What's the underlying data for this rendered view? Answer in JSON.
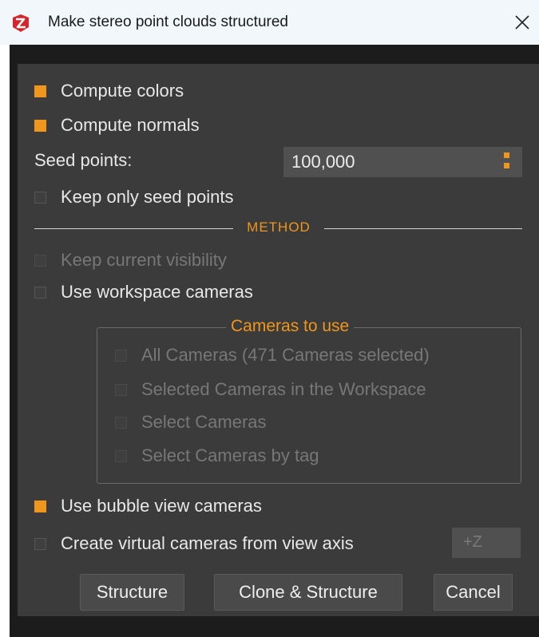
{
  "window": {
    "title": "Make stereo point clouds structured",
    "icon": "app-logo-icon",
    "close_icon": "close-icon"
  },
  "options": {
    "compute_colors": {
      "label": "Compute colors",
      "checked": true
    },
    "compute_normals": {
      "label": "Compute normals",
      "checked": true
    },
    "seed_points": {
      "label": "Seed points:",
      "value": "100,000"
    },
    "keep_only_seed": {
      "label": "Keep only seed points",
      "checked": false
    }
  },
  "method": {
    "title": "METHOD",
    "keep_current_visibility": {
      "label": "Keep current visibility",
      "checked": false,
      "enabled": false
    },
    "use_workspace_cameras": {
      "label": "Use workspace cameras",
      "checked": false
    }
  },
  "cameras_to_use": {
    "title": "Cameras to use",
    "items": [
      {
        "label": "All Cameras (471 Cameras selected)",
        "checked": false,
        "enabled": false
      },
      {
        "label": "Selected Cameras in the Workspace",
        "checked": false,
        "enabled": false
      },
      {
        "label": "Select Cameras",
        "checked": false,
        "enabled": false
      },
      {
        "label": "Select Cameras by tag",
        "checked": false,
        "enabled": false
      }
    ]
  },
  "bubble": {
    "label": "Use bubble view cameras",
    "checked": true
  },
  "virtual": {
    "label": "Create virtual cameras from view axis",
    "checked": false,
    "axis_value": "+Z"
  },
  "buttons": {
    "structure": "Structure",
    "clone_structure": "Clone & Structure",
    "cancel": "Cancel"
  },
  "colors": {
    "accent": "#f0961c",
    "panel_bg": "#3b3b3b",
    "frame_bg": "#1c1c1c",
    "field_bg": "#505050",
    "text": "#e8e8e8",
    "disabled_text": "#777777"
  }
}
